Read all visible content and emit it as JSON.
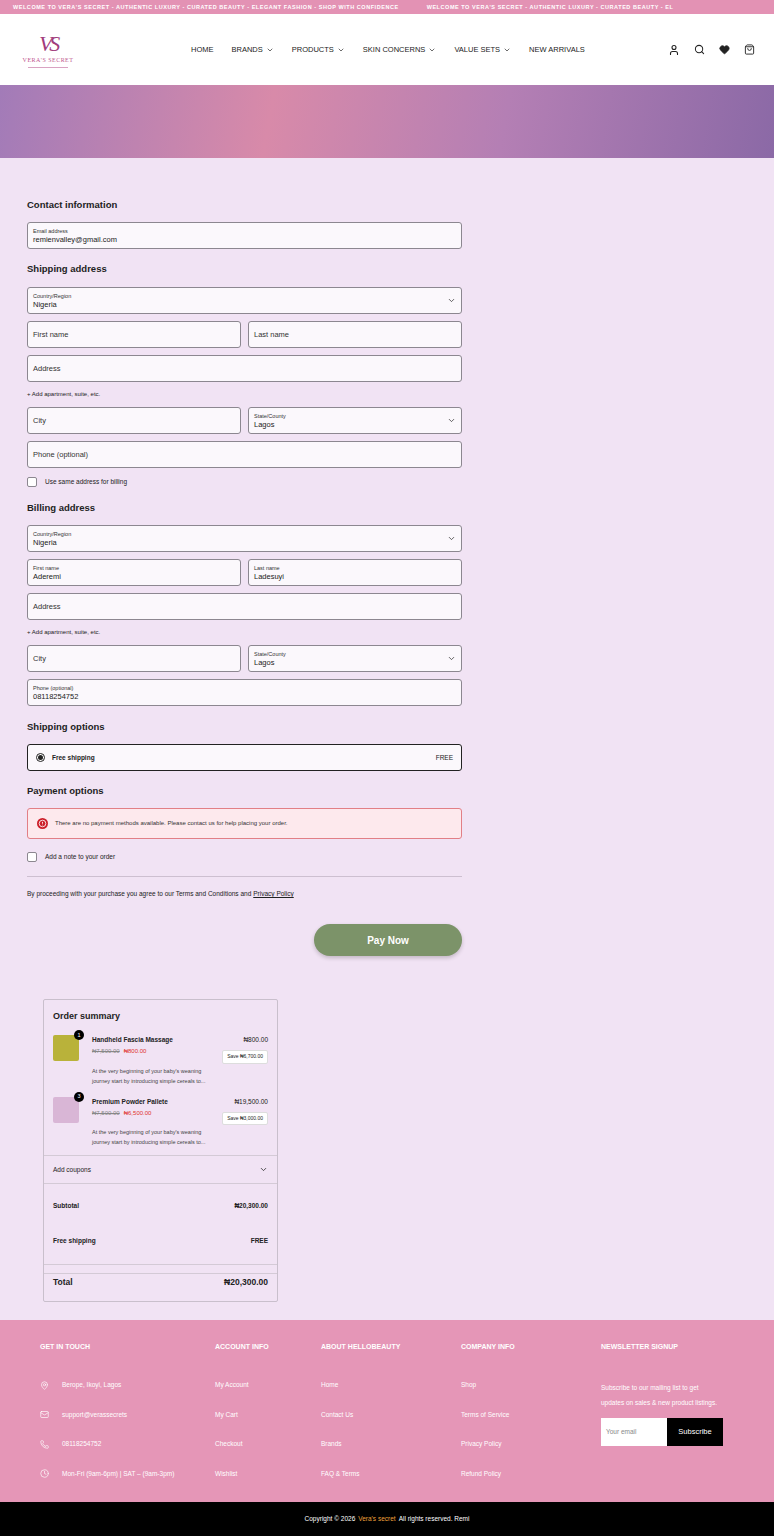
{
  "announcement": [
    "WELCOME TO VERA'S SECRET - AUTHENTIC LUXURY - CURATED BEAUTY - ELEGANT FASHION - SHOP WITH CONFIDENCE",
    "WELCOME TO VERA'S SECRET - AUTHENTIC LUXURY - CURATED BEAUTY - EL"
  ],
  "logo": {
    "monogram": "VS",
    "name": "VERA'S SECRET"
  },
  "nav": [
    {
      "label": "HOME",
      "dropdown": false
    },
    {
      "label": "BRANDS",
      "dropdown": true
    },
    {
      "label": "PRODUCTS",
      "dropdown": true
    },
    {
      "label": "SKIN CONCERNS",
      "dropdown": true
    },
    {
      "label": "VALUE SETS",
      "dropdown": true
    },
    {
      "label": "NEW ARRIVALS",
      "dropdown": false
    }
  ],
  "contact": {
    "heading": "Contact information",
    "email": {
      "label": "Email address",
      "value": "remienvalley@gmail.com",
      "kind": "text"
    }
  },
  "shipping_address": {
    "heading": "Shipping address",
    "country": {
      "label": "Country/Region",
      "value": "Nigeria",
      "kind": "select"
    },
    "first_name": {
      "placeholder": "First name",
      "kind": "text"
    },
    "last_name": {
      "placeholder": "Last name",
      "kind": "text"
    },
    "address": {
      "placeholder": "Address",
      "kind": "text"
    },
    "add_apartment": "+ Add apartment, suite, etc.",
    "city": {
      "placeholder": "City",
      "kind": "text"
    },
    "state": {
      "label": "State/County",
      "value": "Lagos",
      "kind": "select"
    },
    "phone": {
      "placeholder": "Phone (optional)",
      "kind": "text"
    },
    "same_billing": {
      "label": "Use same address for billing",
      "checked": false
    }
  },
  "billing_address": {
    "heading": "Billing address",
    "country": {
      "label": "Country/Region",
      "value": "Nigeria",
      "kind": "select"
    },
    "first_name": {
      "label": "First name",
      "value": "Aderemi",
      "kind": "text"
    },
    "last_name": {
      "label": "Last name",
      "value": "Ladesuyi",
      "kind": "text"
    },
    "address": {
      "placeholder": "Address",
      "kind": "text"
    },
    "add_apartment": "+ Add apartment, suite, etc.",
    "city": {
      "placeholder": "City",
      "kind": "text"
    },
    "state": {
      "label": "State/County",
      "value": "Lagos",
      "kind": "select"
    },
    "phone": {
      "label": "Phone (optional)",
      "value": "08118254752",
      "kind": "text"
    }
  },
  "shipping_options": {
    "heading": "Shipping options",
    "options": [
      {
        "label": "Free shipping",
        "price": "FREE",
        "selected": true
      }
    ]
  },
  "payment": {
    "heading": "Payment options",
    "error": "There are no payment methods available. Please contact us for help placing your order."
  },
  "order_note": {
    "label": "Add a note to your order",
    "checked": false
  },
  "terms": {
    "text": "By proceeding with your purchase you agree to our Terms and Conditions and",
    "link": "Privacy Policy"
  },
  "pay_button": "Pay Now",
  "order_summary": {
    "heading": "Order summary",
    "items": [
      {
        "name": "Handheld Fascia Massage",
        "quantity": "1",
        "line_total": "₦800.00",
        "regular_price": "₦7,500.00",
        "sale_price": "₦800.00",
        "savings": "Save ₦6,700.00",
        "description": [
          "At the very beginning of your baby's weaning",
          "journey start by introducing simple cereals to..."
        ],
        "color": "#b9b23a"
      },
      {
        "name": "Premium Powder Pallete",
        "quantity": "3",
        "line_total": "₦19,500.00",
        "regular_price": "₦7,500.00",
        "sale_price": "₦6,500.00",
        "savings": "Save ₦3,000.00",
        "description": [
          "At the very beginning of your baby's weaning",
          "journey start by introducing simple cereals to..."
        ],
        "color": "#d9b6d6"
      }
    ],
    "coupons": "Add coupons",
    "subtotal": {
      "label": "Subtotal",
      "value": "₦20,300.00"
    },
    "shipping": {
      "label": "Free shipping",
      "value": "FREE"
    },
    "total": {
      "label": "Total",
      "value": "₦20,300.00"
    }
  },
  "footer": {
    "get_in_touch": {
      "heading": "GET IN TOUCH",
      "items": [
        {
          "kind": "address",
          "text": "Berope, Ikoyi, Lagos"
        },
        {
          "kind": "email",
          "text": "support@verassecrets"
        },
        {
          "kind": "phone",
          "text": "08118254752"
        },
        {
          "kind": "hours",
          "text": "Mon-Fri (9am-6pm) | SAT – (9am-3pm)"
        }
      ]
    },
    "columns": [
      {
        "heading": "ACCOUNT INFO",
        "links": [
          "My Account",
          "My Cart",
          "Checkout",
          "Wishlist"
        ]
      },
      {
        "heading": "ABOUT HELLOBEAUTY",
        "links": [
          "Home",
          "Contact Us",
          "Brands",
          "FAQ & Terms"
        ]
      },
      {
        "heading": "COMPANY INFO",
        "links": [
          "Shop",
          "Terms of Service",
          "Privacy Policy",
          "Refund Policy"
        ]
      }
    ],
    "newsletter": {
      "heading": "NEWSLETTER SIGNUP",
      "text": "Subscribe to our mailing list to get updates on sales & new product listings.",
      "placeholder": "Your email",
      "button": "Subscribe"
    }
  },
  "copyright": {
    "prefix": "Copyright © 2026",
    "brand": "Vera's secret",
    "suffix": "All rights reserved. Remi"
  }
}
